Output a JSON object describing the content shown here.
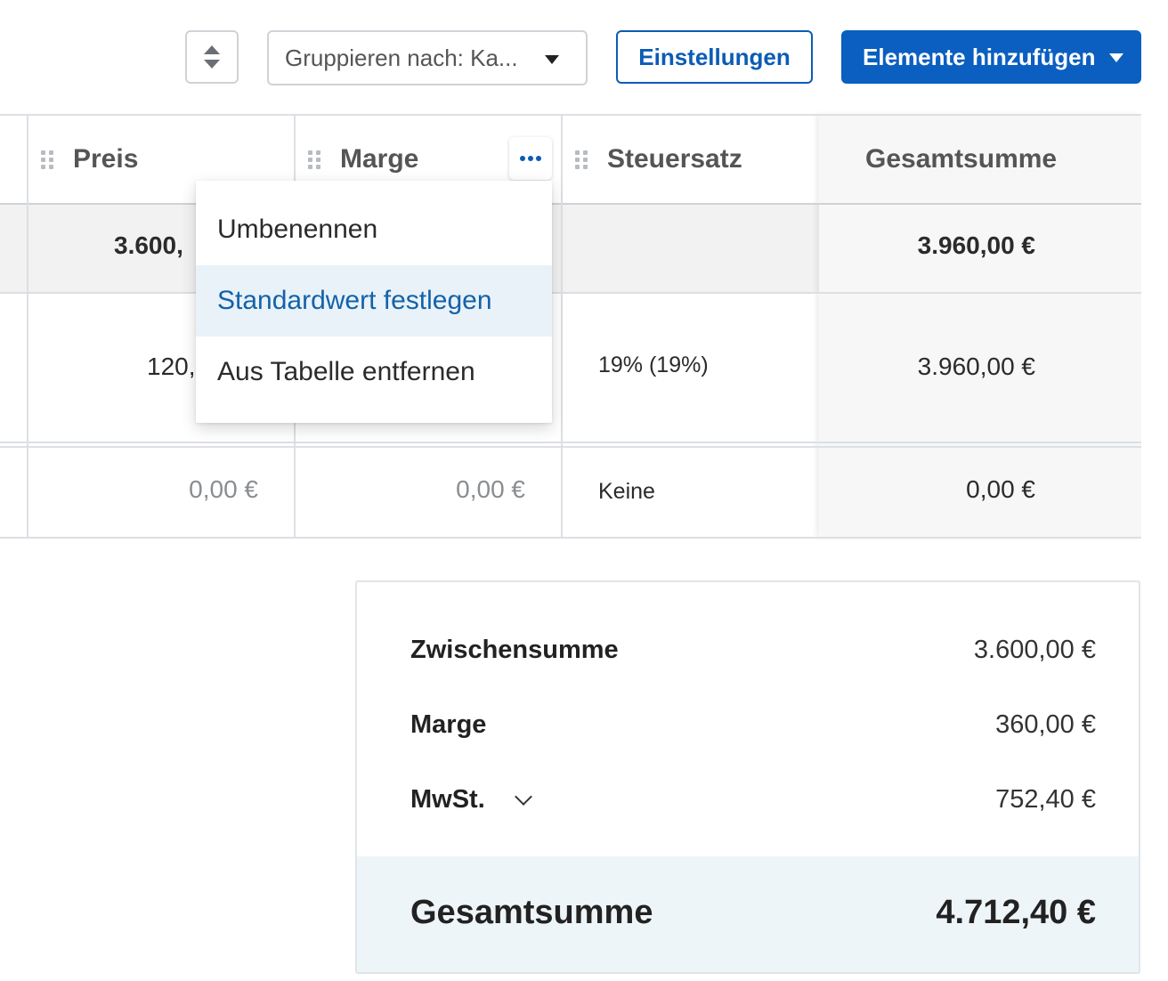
{
  "toolbar": {
    "group_select_value": "Gruppieren nach: Ka...",
    "settings_label": "Einstellungen",
    "add_items_label": "Elemente hinzufügen"
  },
  "table": {
    "columns": {
      "price": "Preis",
      "margin": "Marge",
      "tax_rate": "Steuersatz",
      "total": "Gesamtsumme"
    },
    "group_row": {
      "price": "3.600,",
      "total": "3.960,00 €"
    },
    "item_row": {
      "price": "120,",
      "tax_rate": "19% (19%)",
      "total": "3.960,00 €"
    },
    "empty_row": {
      "price": "0,00 €",
      "margin": "0,00 €",
      "tax_rate": "Keine",
      "total": "0,00 €"
    }
  },
  "column_menu": {
    "items": [
      "Umbenennen",
      "Standardwert festlegen",
      "Aus Tabelle entfernen"
    ],
    "active_index": 1
  },
  "summary": {
    "subtotal_label": "Zwischensumme",
    "subtotal_value": "3.600,00 €",
    "margin_label": "Marge",
    "margin_value": "360,00 €",
    "vat_label": "MwSt.",
    "vat_value": "752,40 €",
    "grand_total_label": "Gesamtsumme",
    "grand_total_value": "4.712,40 €"
  },
  "colors": {
    "primary": "#0a5fc0",
    "menu_active_bg": "#e9f2f9",
    "grand_total_bg": "#eef5f9"
  },
  "icons": [
    "sort-icon",
    "caret-down-icon",
    "drag-handle-icon",
    "more-icon",
    "chevron-down-icon"
  ]
}
